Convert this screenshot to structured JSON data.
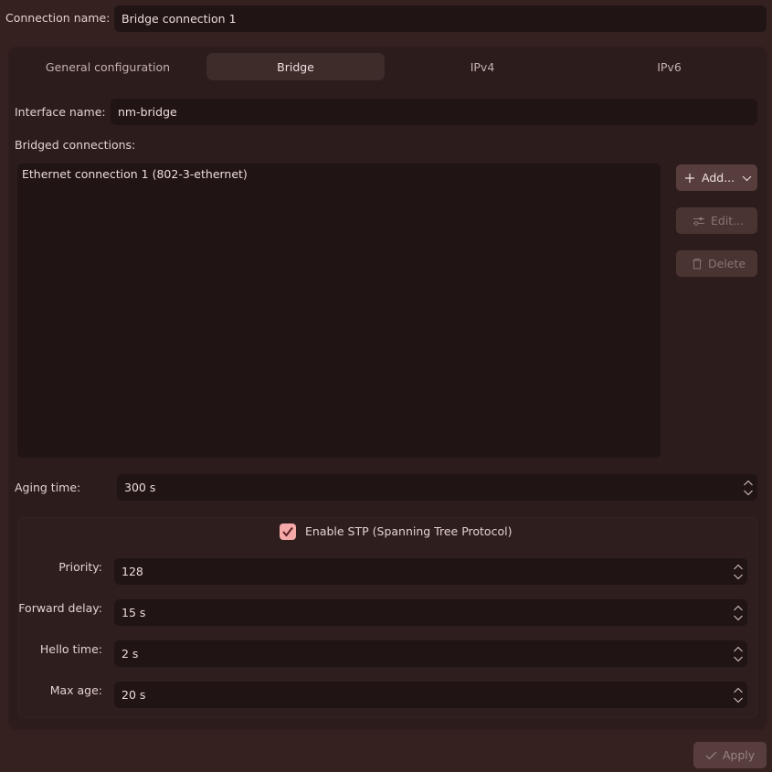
{
  "connection": {
    "label": "Connection name:",
    "value": "Bridge connection 1"
  },
  "tabs": [
    {
      "label": "General configuration",
      "active": false
    },
    {
      "label": "Bridge",
      "active": true
    },
    {
      "label": "IPv4",
      "active": false
    },
    {
      "label": "IPv6",
      "active": false
    }
  ],
  "bridge": {
    "interface_label": "Interface name:",
    "interface_value": "nm-bridge",
    "bridged_label": "Bridged connections:",
    "bridged_connections": [
      "Ethernet connection 1 (802-3-ethernet)"
    ],
    "buttons": {
      "add": "Add...",
      "edit": "Edit...",
      "delete": "Delete"
    },
    "aging_label": "Aging time:",
    "aging_value": "300 s",
    "stp": {
      "label": "Enable STP (Spanning Tree Protocol)",
      "checked": true,
      "priority_label": "Priority:",
      "priority_value": "128",
      "forward_label": "Forward delay:",
      "forward_value": "15 s",
      "hello_label": "Hello time:",
      "hello_value": "2 s",
      "maxage_label": "Max age:",
      "maxage_value": "20 s"
    }
  },
  "footer": {
    "apply": "Apply"
  },
  "icons": {
    "add": "plus-icon",
    "add_menu": "chevron-down-icon",
    "edit": "sliders-icon",
    "delete": "trash-icon",
    "spin": "spin-arrows-icon",
    "apply": "check-icon"
  },
  "colors": {
    "background": "#352120",
    "panel": "#2c1c1b",
    "field": "#201415",
    "button": "#573d3b",
    "accent_checkbox": "#f6a9a9"
  }
}
